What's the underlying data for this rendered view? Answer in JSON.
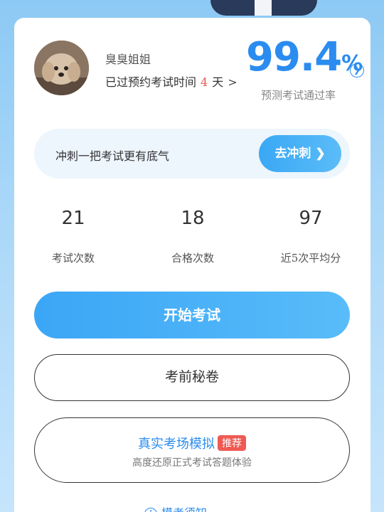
{
  "profile": {
    "username": "臭臭姐姐",
    "exam_prefix": "已过预约考试时间",
    "exam_days": "4",
    "exam_suffix": "天",
    "chevron": ">"
  },
  "pass_rate": {
    "value": "99.4",
    "unit": "%",
    "label": "预测考试通过率",
    "icon": "chevron-circle-icon",
    "color": "#2b8cf0"
  },
  "sprint": {
    "text": "冲刺一把考试更有底气",
    "button_label": "去冲刺 ❯"
  },
  "stats": [
    {
      "value": "21",
      "label": "考试次数"
    },
    {
      "value": "18",
      "label": "合格次数"
    },
    {
      "value": "97",
      "label": "近5次平均分"
    }
  ],
  "actions": {
    "start_label": "开始考试",
    "secret_label": "考前秘卷",
    "sim_title": "真实考场模拟",
    "sim_badge": "推荐",
    "sim_subtitle": "高度还原正式考试答题体验"
  },
  "notice": {
    "label": "模考须知",
    "icon": "info-icon"
  },
  "colors": {
    "accent": "#2b8cf0",
    "badge": "#ef5a54",
    "highlight_number": "#e55a4c"
  }
}
